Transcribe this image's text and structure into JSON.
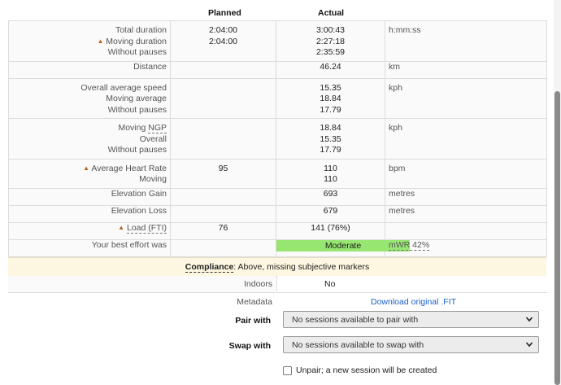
{
  "headers": {
    "planned": "Planned",
    "actual": "Actual"
  },
  "rows": {
    "duration": {
      "labels": [
        "Total duration",
        "Moving duration",
        "Without pauses"
      ],
      "planned": [
        "2:04:00",
        "2:04:00"
      ],
      "actual": [
        "3:00:43",
        "2:27:18",
        "2:35:59"
      ],
      "unit": "h:mm:ss"
    },
    "distance": {
      "label": "Distance",
      "actual": "46.24",
      "unit": "km"
    },
    "speed": {
      "labels": [
        "Overall average speed",
        "Moving average",
        "Without pauses"
      ],
      "actual": [
        "15.35",
        "18.84",
        "17.79"
      ],
      "unit": "kph"
    },
    "ngp": {
      "label_prefix": "Moving ",
      "label_abbr": "NGP",
      "labels": [
        "Overall",
        "Without pauses"
      ],
      "actual": [
        "18.84",
        "15.35",
        "17.79"
      ],
      "unit": "kph"
    },
    "heart_rate": {
      "labels": [
        "Average Heart Rate",
        "Moving"
      ],
      "planned": "95",
      "actual": [
        "110",
        "110"
      ],
      "unit": "bpm"
    },
    "elevation_gain": {
      "label": "Elevation Gain",
      "actual": "693",
      "unit": "metres"
    },
    "elevation_loss": {
      "label": "Elevation Loss",
      "actual": "679",
      "unit": "metres"
    },
    "load": {
      "label": "Load (FTI)",
      "planned": "76",
      "actual": "141 (76%)"
    },
    "effort": {
      "label": "Your best effort was",
      "value": "Moderate",
      "mwr": "mWR 42%",
      "bar_color": "#98e672"
    }
  },
  "compliance": {
    "label": "Compliance",
    "text": ": Above, missing subjective markers"
  },
  "indoors": {
    "label": "Indoors",
    "value": "No"
  },
  "metadata": {
    "label": "Metadata",
    "link": "Download original .FIT"
  },
  "pair_with": {
    "label": "Pair with",
    "selected": "No sessions available to pair with"
  },
  "swap_with": {
    "label": "Swap with",
    "selected": "No sessions available to swap with"
  },
  "unpair": {
    "label": "Unpair; a new session will be created",
    "checked": false
  },
  "colors": {
    "link": "#1a5fc7",
    "caret": "#b5651d",
    "effort_bar": "#98e672",
    "compliance_bg": "#fdf6e0"
  },
  "icons": [
    "caret-up-icon",
    "chevron-down-icon"
  ]
}
